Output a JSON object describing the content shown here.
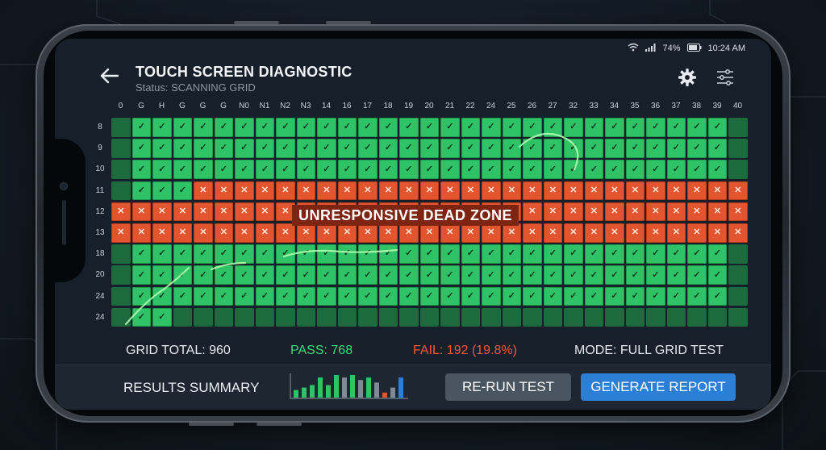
{
  "status_bar": {
    "battery_pct": "74%",
    "time": "10:24 AM"
  },
  "header": {
    "title": "TOUCH SCREEN DIAGNOSTIC",
    "status": "Status: SCANNING GRID"
  },
  "grid": {
    "columns": [
      "0",
      "G",
      "H",
      "G",
      "G",
      "G",
      "N0",
      "N1",
      "N2",
      "N3",
      "14",
      "16",
      "17",
      "18",
      "19",
      "20",
      "21",
      "22",
      "24",
      "25",
      "26",
      "27",
      "32",
      "33",
      "34",
      "35",
      "36",
      "37",
      "38",
      "39",
      "40"
    ],
    "rows": [
      "8",
      "9",
      "10",
      "11",
      "12",
      "13",
      "18",
      "20",
      "24",
      "24"
    ],
    "rows_state": [
      {
        "pass": [
          1,
          29
        ],
        "fail": []
      },
      {
        "pass": [
          1,
          29
        ],
        "fail": []
      },
      {
        "pass": [
          1,
          29
        ],
        "fail": []
      },
      {
        "pass": [
          1,
          3
        ],
        "fail": [
          4,
          30
        ]
      },
      {
        "pass": [],
        "fail": [
          0,
          30
        ]
      },
      {
        "pass": [],
        "fail": [
          0,
          30
        ]
      },
      {
        "pass": [
          1,
          29
        ],
        "fail": []
      },
      {
        "pass": [
          1,
          29
        ],
        "fail": []
      },
      {
        "pass": [
          1,
          29
        ],
        "fail": []
      },
      {
        "pass": [
          1,
          2
        ],
        "fail": []
      }
    ],
    "dead_zone_label": "UNRESPONSIVE DEAD ZONE"
  },
  "stats": {
    "total": "GRID TOTAL: 960",
    "pass": "PASS: 768",
    "fail": "FAIL: 192 (19.8%)",
    "mode": "MODE: FULL GRID TEST"
  },
  "footer": {
    "summary_label": "RESULTS SUMMARY",
    "mini_chart_values": [
      3,
      4,
      5,
      8,
      5,
      9,
      8,
      9,
      7,
      8,
      6,
      2,
      4,
      8
    ],
    "mini_chart_colors": [
      "#2fc266",
      "#2fc266",
      "#2fc266",
      "#2fc266",
      "#2fc266",
      "#2fc266",
      "#7e8a96",
      "#2fc266",
      "#7e8a96",
      "#2fc266",
      "#7e8a96",
      "#e2552e",
      "#7e8a96",
      "#2d7fd6"
    ],
    "rerun_label": "RE-RUN TEST",
    "report_label": "GENERATE REPORT"
  },
  "colors": {
    "pass": "#2fc266",
    "fail": "#e2552e",
    "accent": "#2d7fd6",
    "pass_text": "#3ddb7a",
    "fail_text": "#f0593a"
  }
}
